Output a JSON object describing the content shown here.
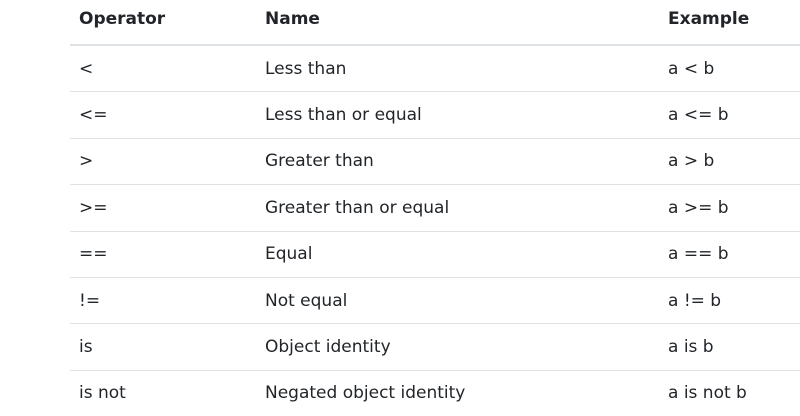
{
  "table": {
    "headers": [
      "Operator",
      "Name",
      "Example"
    ],
    "rows": [
      [
        "<",
        "Less than",
        "a < b"
      ],
      [
        "<=",
        "Less than or equal",
        "a <= b"
      ],
      [
        ">",
        "Greater than",
        "a > b"
      ],
      [
        ">=",
        "Greater than or equal",
        "a >= b"
      ],
      [
        "==",
        "Equal",
        "a == b"
      ],
      [
        "!=",
        "Not equal",
        "a != b"
      ],
      [
        "is",
        "Object identity",
        "a is b"
      ],
      [
        "is not",
        "Negated object identity",
        "a is not b"
      ]
    ]
  }
}
